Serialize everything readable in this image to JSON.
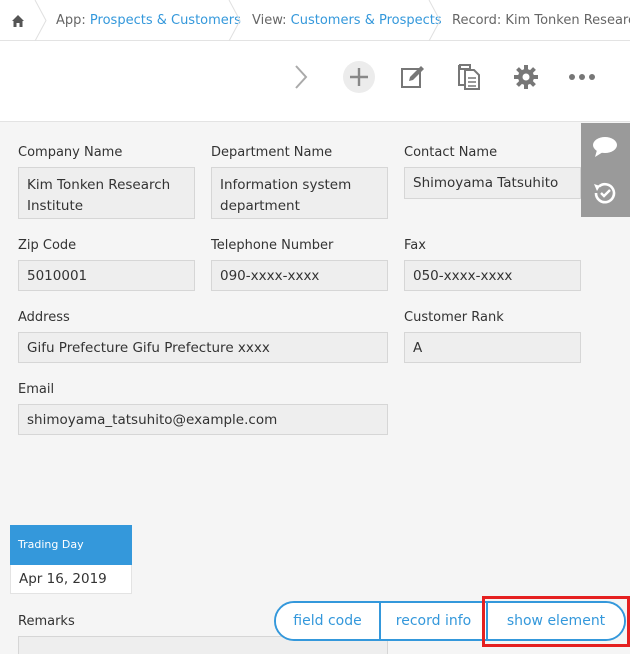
{
  "breadcrumb": {
    "app_prefix": "App: ",
    "app_name": "Prospects & Customers",
    "view_prefix": "View: ",
    "view_name": "Customers & Prospects",
    "record_label": "Record: Kim Tonken Research In"
  },
  "toolbar": {
    "icons": [
      "chevron-right-icon",
      "plus-icon",
      "edit-icon",
      "copy-icon",
      "gear-icon",
      "more-icon"
    ]
  },
  "sidepanel": {
    "icons": [
      "comment-icon",
      "history-icon"
    ]
  },
  "fields": {
    "company_name": {
      "label": "Company Name",
      "value": "Kim Tonken Research Institute"
    },
    "department_name": {
      "label": "Department Name",
      "value": "Information system department"
    },
    "contact_name": {
      "label": "Contact Name",
      "value": "Shimoyama Tatsuhito"
    },
    "zip_code": {
      "label": "Zip Code",
      "value": "5010001"
    },
    "telephone": {
      "label": "Telephone Number",
      "value": "090-xxxx-xxxx"
    },
    "fax": {
      "label": "Fax",
      "value": "050-xxxx-xxxx"
    },
    "address": {
      "label": "Address",
      "value": "Gifu Prefecture Gifu Prefecture xxxx"
    },
    "customer_rank": {
      "label": "Customer Rank",
      "value": "A"
    },
    "email": {
      "label": "Email",
      "value": "shimoyama_tatsuhito@example.com"
    },
    "remarks": {
      "label": "Remarks",
      "value": ""
    }
  },
  "trading_day": {
    "label": "Trading Day",
    "value": "Apr 16, 2019"
  },
  "buttons": {
    "field_code": "field code",
    "record_info": "record info",
    "show_element": "show element"
  },
  "colors": {
    "accent": "#3498db",
    "highlight": "#e52020"
  }
}
